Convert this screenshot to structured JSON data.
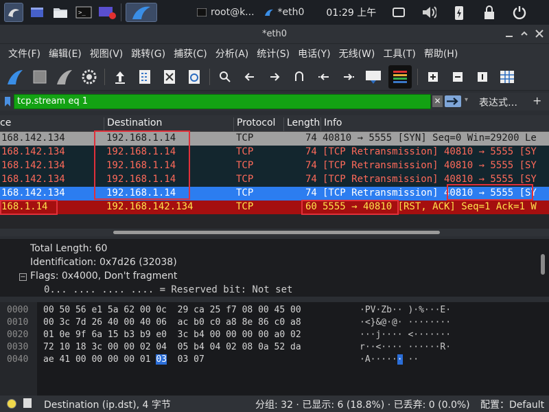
{
  "taskbar": {
    "window1": "root@k...",
    "window2": "*eth0",
    "clock": "01:29 上午"
  },
  "window": {
    "title": "*eth0"
  },
  "menu": [
    "文件(F)",
    "编辑(E)",
    "视图(V)",
    "跳转(G)",
    "捕获(C)",
    "分析(A)",
    "统计(S)",
    "电话(Y)",
    "无线(W)",
    "工具(T)",
    "帮助(H)"
  ],
  "filter": {
    "value": "tcp.stream eq 1",
    "expression_label": "表达式…",
    "clear": "✕",
    "add": "+"
  },
  "columns": [
    "ce",
    "Destination",
    "Protocol",
    "Length",
    "Info"
  ],
  "packets": [
    {
      "src": "168.142.134",
      "dst": "192.168.1.14",
      "proto": "TCP",
      "len": "74",
      "info": "40810 → 5555 [SYN] Seq=0 Win=29200 Le",
      "style": "gray"
    },
    {
      "src": "168.142.134",
      "dst": "192.168.1.14",
      "proto": "TCP",
      "len": "74",
      "info": "[TCP Retransmission] 40810 → 5555 [SY",
      "style": "dark"
    },
    {
      "src": "168.142.134",
      "dst": "192.168.1.14",
      "proto": "TCP",
      "len": "74",
      "info": "[TCP Retransmission] 40810 → 5555 [SY",
      "style": "dark"
    },
    {
      "src": "168.142.134",
      "dst": "192.168.1.14",
      "proto": "TCP",
      "len": "74",
      "info": "[TCP Retransmission] 40810 → 5555 [SY",
      "style": "dark"
    },
    {
      "src": "168.142.134",
      "dst": "192.168.1.14",
      "proto": "TCP",
      "len": "74",
      "info": "[TCP Retransmission] 40810 → 5555 [SY",
      "style": "sel"
    },
    {
      "src": "168.1.14",
      "dst": "192.168.142.134",
      "proto": "TCP",
      "len": "60",
      "info": "5555 → 40810 [RST, ACK] Seq=1 Ack=1 W",
      "style": "red"
    }
  ],
  "details": {
    "line1": "Total Length: 60",
    "line2": "Identification: 0x7d26 (32038)",
    "line3": "Flags: 0x4000, Don't fragment",
    "line4": "0... .... .... .... = Reserved bit: Not set",
    "collapse": "−"
  },
  "hex": [
    {
      "off": "0000",
      "bytes": "00 50 56 e1 5a 62 00 0c  29 ca 25 f7 08 00 45 00",
      "ascii": "·PV·Zb·· )·%···E·"
    },
    {
      "off": "0010",
      "bytes": "00 3c 7d 26 40 00 40 06  ac b0 c0 a8 8e 86 c0 a8",
      "ascii": "·<}&@·@· ········"
    },
    {
      "off": "0020",
      "bytes": "01 0e 9f 6a 15 b3 b9 e0  3c b4 00 00 00 00 a0 02",
      "ascii": "···j···· <·······"
    },
    {
      "off": "0030",
      "bytes": "72 10 18 3c 00 00 02 04  05 b4 04 02 08 0a 52 da",
      "ascii": "r··<···· ······R·"
    },
    {
      "off": "0040",
      "bytes_pre": "ae 41 00 00 00 00 01 ",
      "bytes_hl": "03",
      "bytes_post": "  03 07",
      "ascii_pre": "·A·····",
      "ascii_hl": "·",
      "ascii_post": " ··"
    }
  ],
  "status": {
    "field": "Destination (ip.dst), 4 字节",
    "stats": "分组: 32 · 已显示: 6 (18.8%) · 已丢弃: 0 (0.0%)",
    "profile": "配置：Default"
  },
  "icons": {
    "row_color_sel": "#2c7df0",
    "row_color_red": "#a50f0f",
    "filter_green": "#13a213"
  }
}
